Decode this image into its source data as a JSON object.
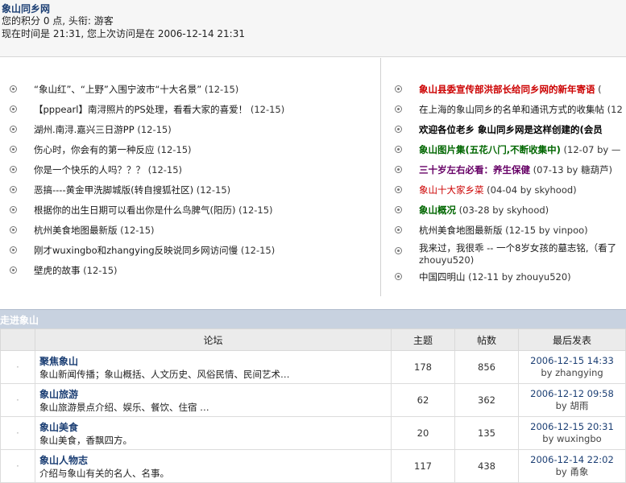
{
  "header": {
    "site_title": "象山同乡网",
    "score_line": "您的积分 0 点, 头衔: 游客",
    "time_line": "现在时间是 21:31, 您上次访问是在 2006-12-14 21:31"
  },
  "news_left": [
    {
      "title": "“象山红”、“上野”入围宁波市“十大名景”",
      "date": "(12-15)"
    },
    {
      "title": "【pppearl】南浔照片的PS处理，看看大家的喜爱！",
      "date": "(12-15)"
    },
    {
      "title": "湖州.南浔.嘉兴三日游PP",
      "date": "(12-15)"
    },
    {
      "title": "伤心时，你会有的第一种反应",
      "date": "(12-15)"
    },
    {
      "title": "你是一个快乐的人吗？？？",
      "date": "(12-15)"
    },
    {
      "title": "恶搞----黄金甲洗脚城版(转自搜狐社区)",
      "date": "(12-15)"
    },
    {
      "title": "根据你的出生日期可以看出你是什么鸟脾气(阳历)",
      "date": "(12-15)"
    },
    {
      "title": "杭州美食地图最新版",
      "date": "(12-15)"
    },
    {
      "title": "刚才wuxingbo和zhangying反映说同乡网访问慢",
      "date": "(12-15)"
    },
    {
      "title": "壁虎的故事",
      "date": "(12-15)"
    }
  ],
  "news_right": [
    {
      "title": "象山县委宣传部洪部长给同乡网的新年寄语",
      "date": "(",
      "color": "#cc0000",
      "bold": true
    },
    {
      "title": "在上海的象山同乡的名单和通讯方式的收集帖",
      "date": "(12",
      "color": "#1a1a1a",
      "bold": false
    },
    {
      "title": "欢迎各位老乡 象山同乡网是这样创建的(会员",
      "date": "",
      "color": "#000000",
      "bold": true
    },
    {
      "title": "象山图片集(五花八门,不断收集中)",
      "date": "(12-07 by —",
      "color": "#006600",
      "bold": true
    },
    {
      "title": "三十岁左右必看：养生保健",
      "date": "(07-13 by 糖葫芦)",
      "color": "#660066",
      "bold": true
    },
    {
      "title": "象山十大家乡菜",
      "date": "(04-04 by skyhood)",
      "color": "#cc0000",
      "bold": false
    },
    {
      "title": "象山概况",
      "date": "(03-28 by skyhood)",
      "color": "#006600",
      "bold": true
    },
    {
      "title": "杭州美食地图最新版",
      "date": "(12-15 by vinpoo)",
      "color": "#1a1a1a",
      "bold": false
    },
    {
      "title": "我来过，我很乖 -- 一个8岁女孩的墓志铭,（看了",
      "date": "zhouyu520)",
      "color": "#1a1a1a",
      "bold": false
    },
    {
      "title": "中国四明山",
      "date": "(12-11 by zhouyu520)",
      "color": "#1a1a1a",
      "bold": false
    }
  ],
  "section": {
    "title": "走进象山"
  },
  "table": {
    "headers": [
      "论坛",
      "主题",
      "帖数",
      "最后发表"
    ],
    "rows": [
      {
        "name": "聚焦象山",
        "desc": "象山新闻传播；象山概括、人文历史、风俗民情、民间艺术…",
        "topics": "178",
        "posts": "856",
        "last_time": "2006-12-15 14:33",
        "last_by": "by zhangying"
      },
      {
        "name": "象山旅游",
        "desc": "象山旅游景点介绍、娱乐、餐饮、住宿 …",
        "topics": "62",
        "posts": "362",
        "last_time": "2006-12-12 09:58",
        "last_by": "by 胡雨"
      },
      {
        "name": "象山美食",
        "desc": "象山美食，香飘四方。",
        "topics": "20",
        "posts": "135",
        "last_time": "2006-12-15 20:31",
        "last_by": "by wuxingbo"
      },
      {
        "name": "象山人物志",
        "desc": "介绍与象山有关的名人、名事。",
        "topics": "117",
        "posts": "438",
        "last_time": "2006-12-14 22:02",
        "last_by": "by 甬象"
      }
    ]
  }
}
